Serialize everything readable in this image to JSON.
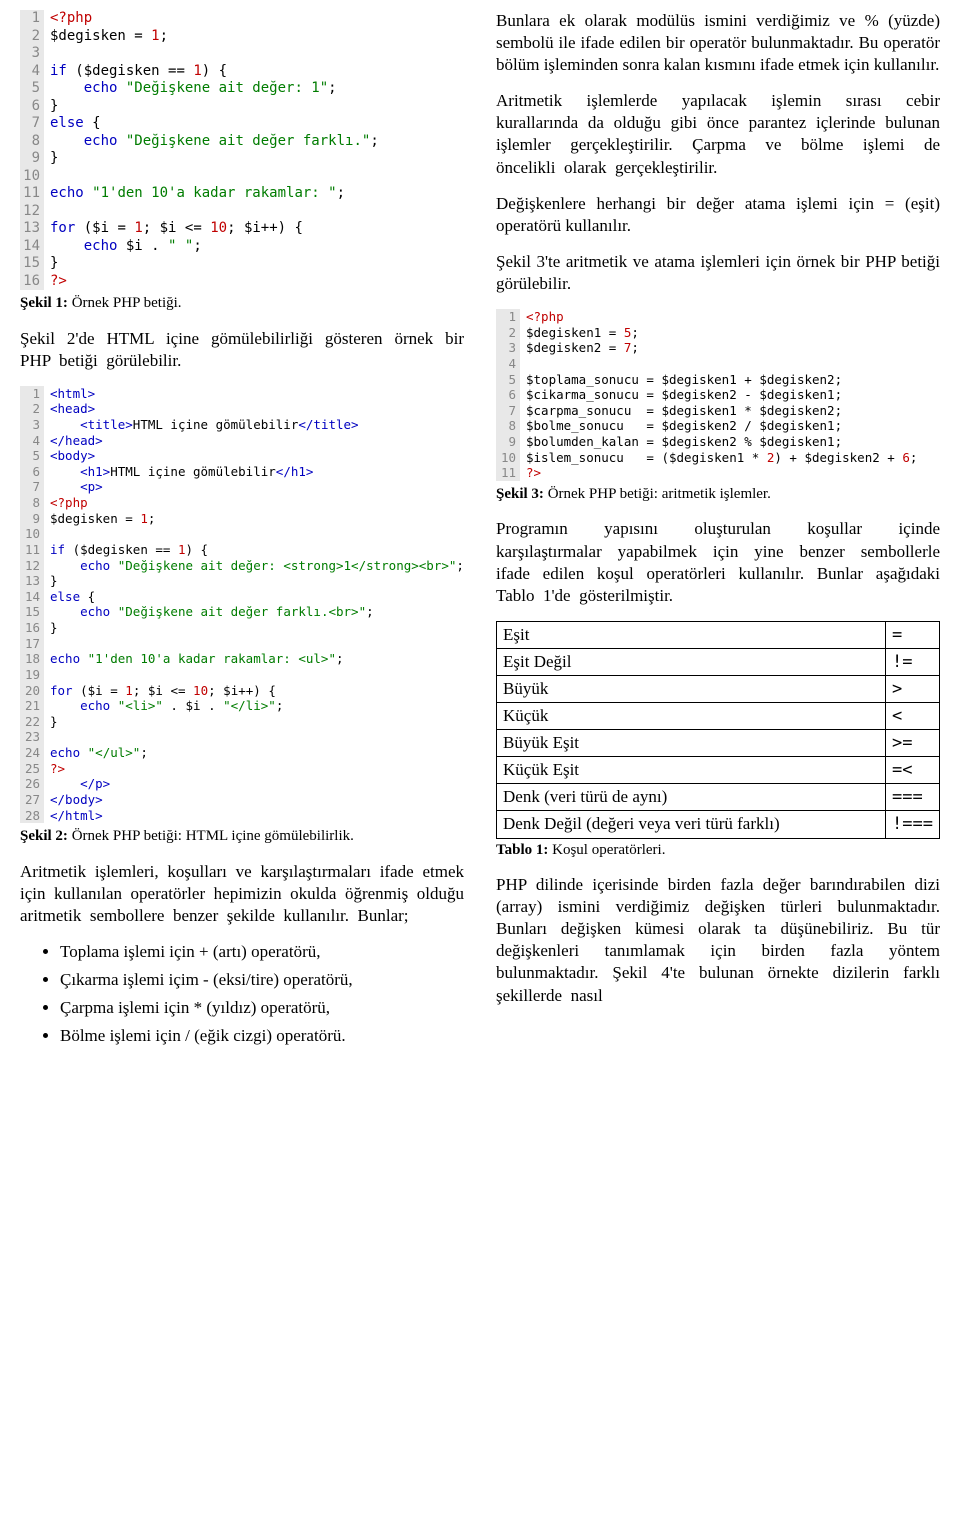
{
  "code1": {
    "lines": [
      {
        "n": 1,
        "h": "<span class='pp'>&lt;?php</span>"
      },
      {
        "n": 2,
        "h": "<span class='var'>$degisken</span> <span class='op'>=</span> <span class='num'>1</span>;"
      },
      {
        "n": 3,
        "h": ""
      },
      {
        "n": 4,
        "h": "<span class='kw'>if</span> (<span class='var'>$degisken</span> <span class='op'>==</span> <span class='num'>1</span>) {"
      },
      {
        "n": 5,
        "h": "    <span class='kw'>echo</span> <span class='str'>\"Değişkene ait değer: 1\"</span>;"
      },
      {
        "n": 6,
        "h": "}"
      },
      {
        "n": 7,
        "h": "<span class='kw'>else</span> {"
      },
      {
        "n": 8,
        "h": "    <span class='kw'>echo</span> <span class='str'>\"Değişkene ait değer farklı.\"</span>;"
      },
      {
        "n": 9,
        "h": "}"
      },
      {
        "n": 10,
        "h": ""
      },
      {
        "n": 11,
        "h": "<span class='kw'>echo</span> <span class='str'>\"1'den 10'a kadar rakamlar: \"</span>;"
      },
      {
        "n": 12,
        "h": ""
      },
      {
        "n": 13,
        "h": "<span class='kw'>for</span> (<span class='var'>$i</span> <span class='op'>=</span> <span class='num'>1</span>; <span class='var'>$i</span> <span class='op'>&lt;=</span> <span class='num'>10</span>; <span class='var'>$i</span><span class='op'>++</span>) {"
      },
      {
        "n": 14,
        "h": "    <span class='kw'>echo</span> <span class='var'>$i</span> . <span class='str'>\" \"</span>;"
      },
      {
        "n": 15,
        "h": "}"
      },
      {
        "n": 16,
        "h": "<span class='pp'>?&gt;</span>"
      }
    ]
  },
  "caption1_label": "Şekil 1:",
  "caption1_text": " Örnek PHP betiği.",
  "para_l1": "Şekil 2'de HTML içine gömülebilirliği gösteren örnek bir PHP betiği görülebilir.",
  "code2": {
    "lines": [
      {
        "n": 1,
        "h": "<span class='tag'>&lt;html&gt;</span>"
      },
      {
        "n": 2,
        "h": "<span class='tag'>&lt;head&gt;</span>"
      },
      {
        "n": 3,
        "h": "    <span class='tag'>&lt;title&gt;</span>HTML içine gömülebilir<span class='tag'>&lt;/title&gt;</span>"
      },
      {
        "n": 4,
        "h": "<span class='tag'>&lt;/head&gt;</span>"
      },
      {
        "n": 5,
        "h": "<span class='tag'>&lt;body&gt;</span>"
      },
      {
        "n": 6,
        "h": "    <span class='tag'>&lt;h1&gt;</span>HTML içine gömülebilir<span class='tag'>&lt;/h1&gt;</span>"
      },
      {
        "n": 7,
        "h": "    <span class='tag'>&lt;p&gt;</span>"
      },
      {
        "n": 8,
        "h": "<span class='pp'>&lt;?php</span>"
      },
      {
        "n": 9,
        "h": "<span class='var'>$degisken</span> = <span class='num'>1</span>;"
      },
      {
        "n": 10,
        "h": ""
      },
      {
        "n": 11,
        "h": "<span class='kw'>if</span> (<span class='var'>$degisken</span> == <span class='num'>1</span>) {"
      },
      {
        "n": 12,
        "h": "    <span class='kw'>echo</span> <span class='str'>\"Değişkene ait değer: &lt;strong&gt;1&lt;/strong&gt;&lt;br&gt;\"</span>;"
      },
      {
        "n": 13,
        "h": "}"
      },
      {
        "n": 14,
        "h": "<span class='kw'>else</span> {"
      },
      {
        "n": 15,
        "h": "    <span class='kw'>echo</span> <span class='str'>\"Değişkene ait değer farklı.&lt;br&gt;\"</span>;"
      },
      {
        "n": 16,
        "h": "}"
      },
      {
        "n": 17,
        "h": ""
      },
      {
        "n": 18,
        "h": "<span class='kw'>echo</span> <span class='str'>\"1'den 10'a kadar rakamlar: &lt;ul&gt;\"</span>;"
      },
      {
        "n": 19,
        "h": ""
      },
      {
        "n": 20,
        "h": "<span class='kw'>for</span> (<span class='var'>$i</span> = <span class='num'>1</span>; <span class='var'>$i</span> &lt;= <span class='num'>10</span>; <span class='var'>$i</span>++) {"
      },
      {
        "n": 21,
        "h": "    <span class='kw'>echo</span> <span class='str'>\"&lt;li&gt;\"</span> . <span class='var'>$i</span> . <span class='str'>\"&lt;/li&gt;\"</span>;"
      },
      {
        "n": 22,
        "h": "}"
      },
      {
        "n": 23,
        "h": ""
      },
      {
        "n": 24,
        "h": "<span class='kw'>echo</span> <span class='str'>\"&lt;/ul&gt;\"</span>;"
      },
      {
        "n": 25,
        "h": "<span class='pp'>?&gt;</span>"
      },
      {
        "n": 26,
        "h": "    <span class='tag'>&lt;/p&gt;</span>"
      },
      {
        "n": 27,
        "h": "<span class='tag'>&lt;/body&gt;</span>"
      },
      {
        "n": 28,
        "h": "<span class='tag'>&lt;/html&gt;</span>"
      }
    ]
  },
  "caption2_label": "Şekil 2:",
  "caption2_text": " Örnek PHP betiği: HTML içine gömülebilirlik.",
  "para_l2": "Aritmetik işlemleri, koşulları ve karşılaştırmaları ifade etmek için kullanılan operatörler hepimizin okulda öğrenmiş olduğu aritmetik sembollere benzer şekilde kullanılır. Bunlar;",
  "bullets": [
    "Toplama işlemi için + (artı) operatörü,",
    "Çıkarma işlemi içim - (eksi/tire) operatörü,",
    "Çarpma işlemi için * (yıldız) operatörü,",
    "Bölme işlemi için / (eğik cizgi) operatörü."
  ],
  "para_r1": "Bunlara ek olarak modülüs ismini verdiğimiz ve % (yüzde) sembolü ile ifade edilen bir operatör bulunmaktadır. Bu operatör bölüm işleminden sonra kalan kısmını ifade etmek için kullanılır.",
  "para_r2": "Aritmetik işlemlerde yapılacak işlemin sırası cebir kurallarında da olduğu gibi önce parantez içlerinde bulunan işlemler gerçekleştirilir. Çarpma ve bölme işlemi de öncelikli olarak gerçekleştirilir.",
  "para_r3": "Değişkenlere herhangi bir değer atama işlemi için = (eşit) operatörü kullanılır.",
  "para_r4": "Şekil 3'te aritmetik ve atama işlemleri için örnek bir PHP betiği görülebilir.",
  "code3": {
    "lines": [
      {
        "n": 1,
        "h": "<span class='pp'>&lt;?php</span>"
      },
      {
        "n": 2,
        "h": "<span class='var'>$degisken1</span> = <span class='num'>5</span>;"
      },
      {
        "n": 3,
        "h": "<span class='var'>$degisken2</span> = <span class='num'>7</span>;"
      },
      {
        "n": 4,
        "h": ""
      },
      {
        "n": 5,
        "h": "<span class='var'>$toplama_sonucu</span> = <span class='var'>$degisken1</span> + <span class='var'>$degisken2</span>;"
      },
      {
        "n": 6,
        "h": "<span class='var'>$cikarma_sonucu</span> = <span class='var'>$degisken2</span> - <span class='var'>$degisken1</span>;"
      },
      {
        "n": 7,
        "h": "<span class='var'>$carpma_sonucu</span>  = <span class='var'>$degisken1</span> * <span class='var'>$degisken2</span>;"
      },
      {
        "n": 8,
        "h": "<span class='var'>$bolme_sonucu</span>   = <span class='var'>$degisken2</span> / <span class='var'>$degisken1</span>;"
      },
      {
        "n": 9,
        "h": "<span class='var'>$bolumden_kalan</span> = <span class='var'>$degisken2</span> % <span class='var'>$degisken1</span>;"
      },
      {
        "n": 10,
        "h": "<span class='var'>$islem_sonucu</span>   = (<span class='var'>$degisken1</span> * <span class='num'>2</span>) + <span class='var'>$degisken2</span> + <span class='num'>6</span>;"
      },
      {
        "n": 11,
        "h": "<span class='pp'>?&gt;</span>"
      }
    ]
  },
  "caption3_label": "Şekil 3:",
  "caption3_text": " Örnek PHP betiği: aritmetik işlemler.",
  "para_r5": "Programın yapısını oluşturulan koşullar içinde karşılaştırmalar yapabilmek için yine benzer sembollerle ifade edilen koşul operatörleri kullanılır. Bunlar aşağıdaki Tablo 1'de gösterilmiştir.",
  "table": [
    {
      "name": "Eşit",
      "sym": "="
    },
    {
      "name": "Eşit Değil",
      "sym": "!="
    },
    {
      "name": "Büyük",
      "sym": ">"
    },
    {
      "name": "Küçük",
      "sym": "<"
    },
    {
      "name": "Büyük Eşit",
      "sym": ">="
    },
    {
      "name": "Küçük Eşit",
      "sym": "=<"
    },
    {
      "name": "Denk (veri türü de aynı)",
      "sym": "==="
    },
    {
      "name": "Denk Değil (değeri veya veri türü farklı)",
      "sym": "!==="
    }
  ],
  "caption4_label": "Tablo 1:",
  "caption4_text": " Koşul operatörleri.",
  "para_r6": "PHP dilinde içerisinde birden fazla değer barındırabilen dizi (array) ismini verdiğimiz değişken türleri bulunmaktadır. Bunları değişken kümesi olarak ta düşünebiliriz. Bu tür değişkenleri tanımlamak için birden fazla yöntem bulunmaktadır. Şekil 4'te bulunan örnekte dizilerin farklı şekillerde nasıl"
}
